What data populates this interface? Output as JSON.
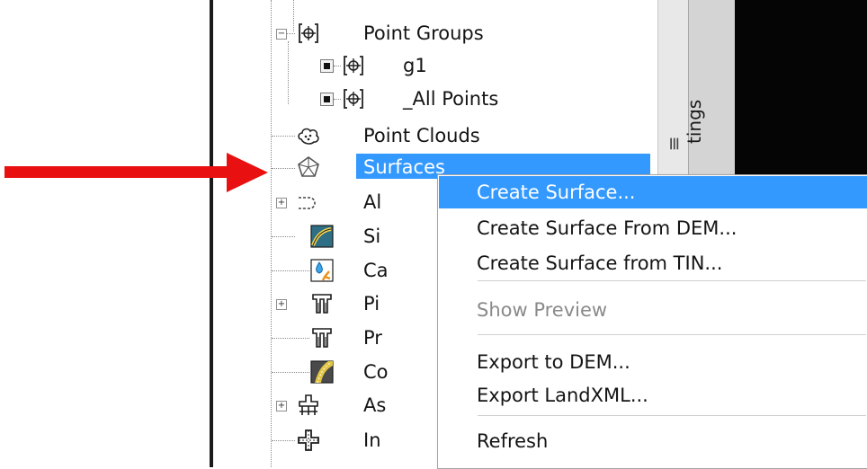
{
  "tree": {
    "items": [
      {
        "label": "Point Groups"
      },
      {
        "label": "g1"
      },
      {
        "label": "_All Points"
      },
      {
        "label": "Point Clouds"
      },
      {
        "label": "Surfaces"
      },
      {
        "label": "Al"
      },
      {
        "label": "Si"
      },
      {
        "label": "Ca"
      },
      {
        "label": "Pi"
      },
      {
        "label": "Pr"
      },
      {
        "label": "Co"
      },
      {
        "label": "As"
      },
      {
        "label": "In"
      }
    ]
  },
  "side_tab": {
    "label": "tings"
  },
  "context_menu": {
    "items": [
      {
        "label": "Create Surface..."
      },
      {
        "label": "Create Surface From DEM..."
      },
      {
        "label": "Create Surface from TIN..."
      },
      {
        "label": "Show Preview"
      },
      {
        "label": "Export to DEM..."
      },
      {
        "label": "Export LandXML..."
      },
      {
        "label": "Refresh"
      }
    ]
  },
  "colors": {
    "selection": "#3399ff",
    "arrow": "#e81010",
    "disabled_text": "#8a8a8a"
  }
}
